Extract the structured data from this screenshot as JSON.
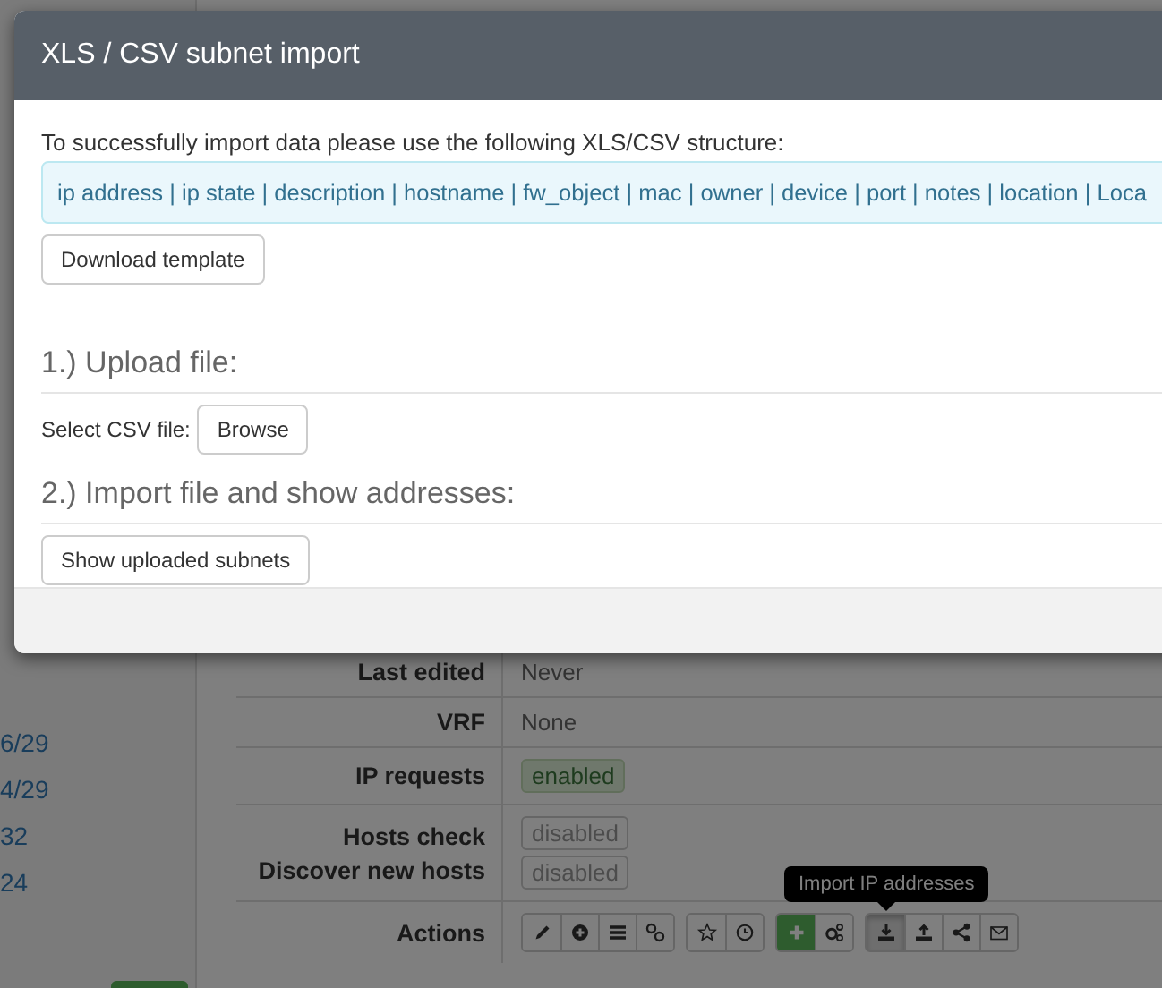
{
  "sidebar": {
    "items": [
      "6/29",
      "4/29",
      "32",
      "24"
    ]
  },
  "details": {
    "rows": [
      {
        "label": "Last edited",
        "values": [
          {
            "kind": "text",
            "text": "Never"
          }
        ]
      },
      {
        "label": "VRF",
        "values": [
          {
            "kind": "text",
            "text": "None"
          }
        ]
      },
      {
        "label": "IP requests",
        "values": [
          {
            "kind": "badge",
            "text": "enabled",
            "on": true
          }
        ]
      },
      {
        "labels": [
          "Hosts check",
          "Discover new hosts"
        ],
        "values": [
          {
            "kind": "badge",
            "text": "disabled",
            "on": false
          },
          {
            "kind": "badge",
            "text": "disabled",
            "on": false
          }
        ]
      },
      {
        "label": "Actions",
        "kind": "actions"
      }
    ],
    "action_groups": [
      [
        {
          "kind": "default",
          "selected": false
        },
        {
          "kind": "default",
          "selected": false
        },
        {
          "kind": "default",
          "selected": false
        },
        {
          "kind": "default",
          "selected": false
        }
      ],
      [
        {
          "kind": "default",
          "selected": false
        },
        {
          "kind": "default",
          "selected": false
        }
      ],
      [
        {
          "kind": "success",
          "selected": false
        },
        {
          "kind": "default",
          "selected": false
        }
      ],
      [
        {
          "kind": "default",
          "selected": true
        },
        {
          "kind": "default",
          "selected": false
        },
        {
          "kind": "default",
          "selected": false
        },
        {
          "kind": "default",
          "selected": false
        }
      ]
    ],
    "tooltip": "Import IP addresses"
  },
  "modal": {
    "title": "XLS / CSV subnet import",
    "intro": "To successfully import data please use the following XLS/CSV structure:",
    "structure": "ip address | ip state | description | hostname | fw_object | mac | owner | device | port | notes | location | Loca",
    "download_button": "Download template",
    "step1": "1.) Upload file:",
    "file_label": "Select CSV file:",
    "browse_button": "Browse",
    "step2": "2.) Import file and show addresses:",
    "show_button": "Show uploaded subnets"
  }
}
